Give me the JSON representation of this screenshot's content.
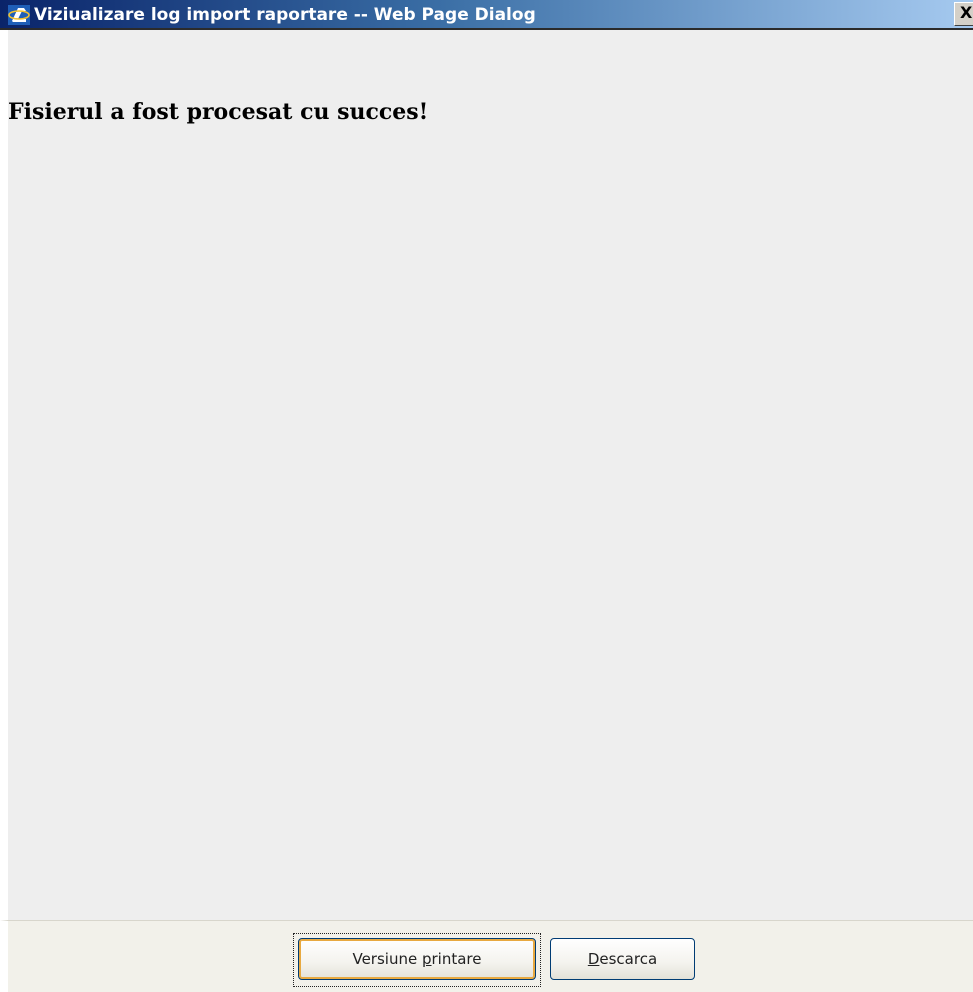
{
  "window": {
    "title": "Viziualizare log import raportare -- Web Page Dialog",
    "icon": "internet-explorer-icon",
    "close_label": "X",
    "titlebar_color": "#0a246a"
  },
  "content": {
    "message": "Fisierul a fost procesat cu succes!",
    "background": "#eeeeee"
  },
  "footer": {
    "print_button": {
      "before": "Versiune ",
      "accel": "p",
      "after": "rintare"
    },
    "download_button": {
      "before": "",
      "accel": "D",
      "after": "escarca"
    }
  }
}
